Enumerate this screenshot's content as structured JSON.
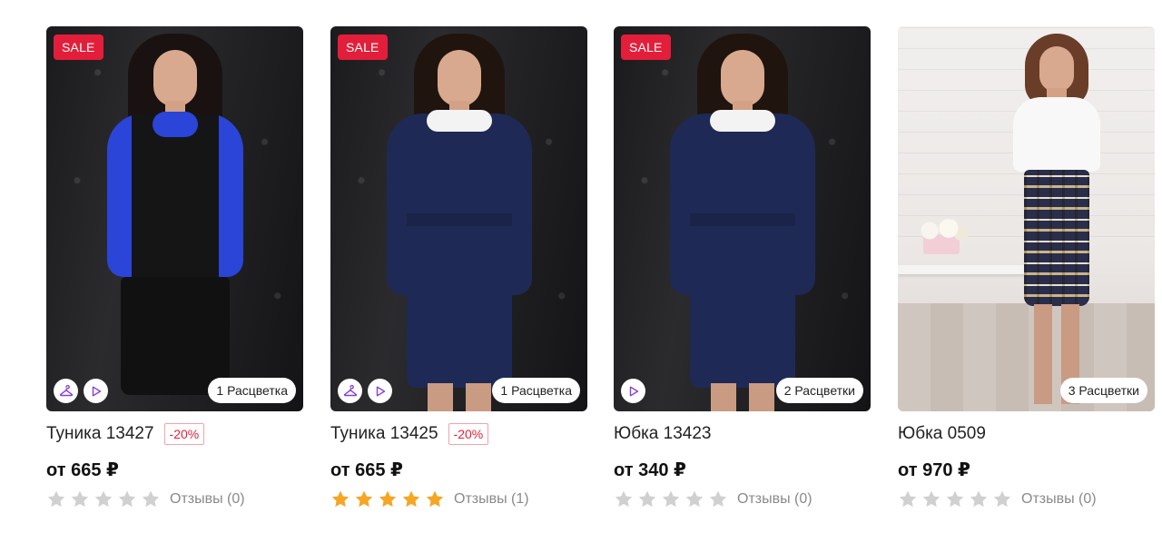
{
  "accent_color": "#e31e3a",
  "star_color_on": "#f5a623",
  "star_color_off": "#d0d0d0",
  "products": [
    {
      "sale_label": "SALE",
      "colors_label": "1 Расцветка",
      "title": "Туника 13427",
      "discount": "-20%",
      "price": "от 665 ₽",
      "rating": 0,
      "reviews": "Отзывы (0)",
      "icons": [
        "hanger-icon",
        "play-icon"
      ]
    },
    {
      "sale_label": "SALE",
      "colors_label": "1 Расцветка",
      "title": "Туника 13425",
      "discount": "-20%",
      "price": "от 665 ₽",
      "rating": 5,
      "reviews": "Отзывы (1)",
      "icons": [
        "hanger-icon",
        "play-icon"
      ]
    },
    {
      "sale_label": "SALE",
      "colors_label": "2 Расцветки",
      "title": "Юбка 13423",
      "discount": "",
      "price": "от 340 ₽",
      "rating": 0,
      "reviews": "Отзывы (0)",
      "icons": [
        "play-icon"
      ]
    },
    {
      "sale_label": "",
      "colors_label": "3 Расцветки",
      "title": "Юбка 0509",
      "discount": "",
      "price": "от 970 ₽",
      "rating": 0,
      "reviews": "Отзывы (0)",
      "icons": []
    }
  ]
}
